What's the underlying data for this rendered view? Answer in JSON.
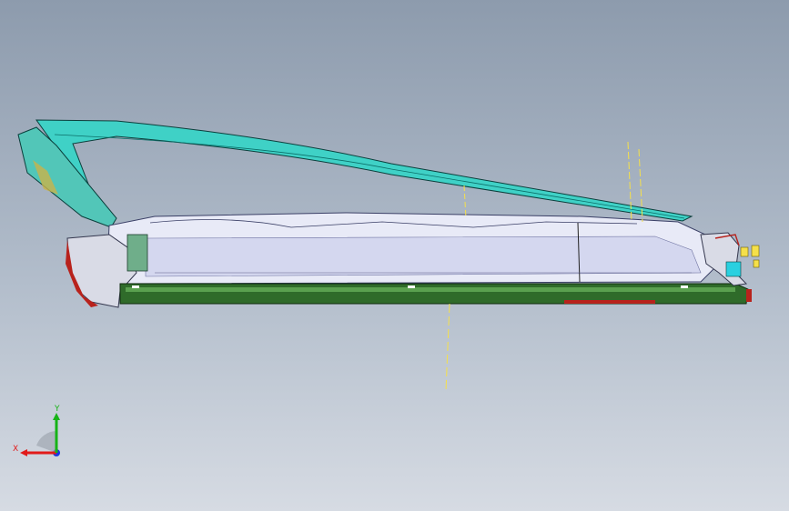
{
  "viewport": {
    "background_top": "#8d9bad",
    "background_bottom": "#d6dbe3",
    "model": "side-view-assembly"
  },
  "triad": {
    "x_label": "X",
    "y_label": "Y",
    "x_color": "#e11a1a",
    "y_color": "#16b316",
    "z_color": "#1a39e1"
  },
  "colors": {
    "teal": "#3fd1c6",
    "body": "#e8eaf7",
    "green": "#2f6b2a",
    "red": "#b8221c",
    "yellow": "#f5e04a"
  }
}
